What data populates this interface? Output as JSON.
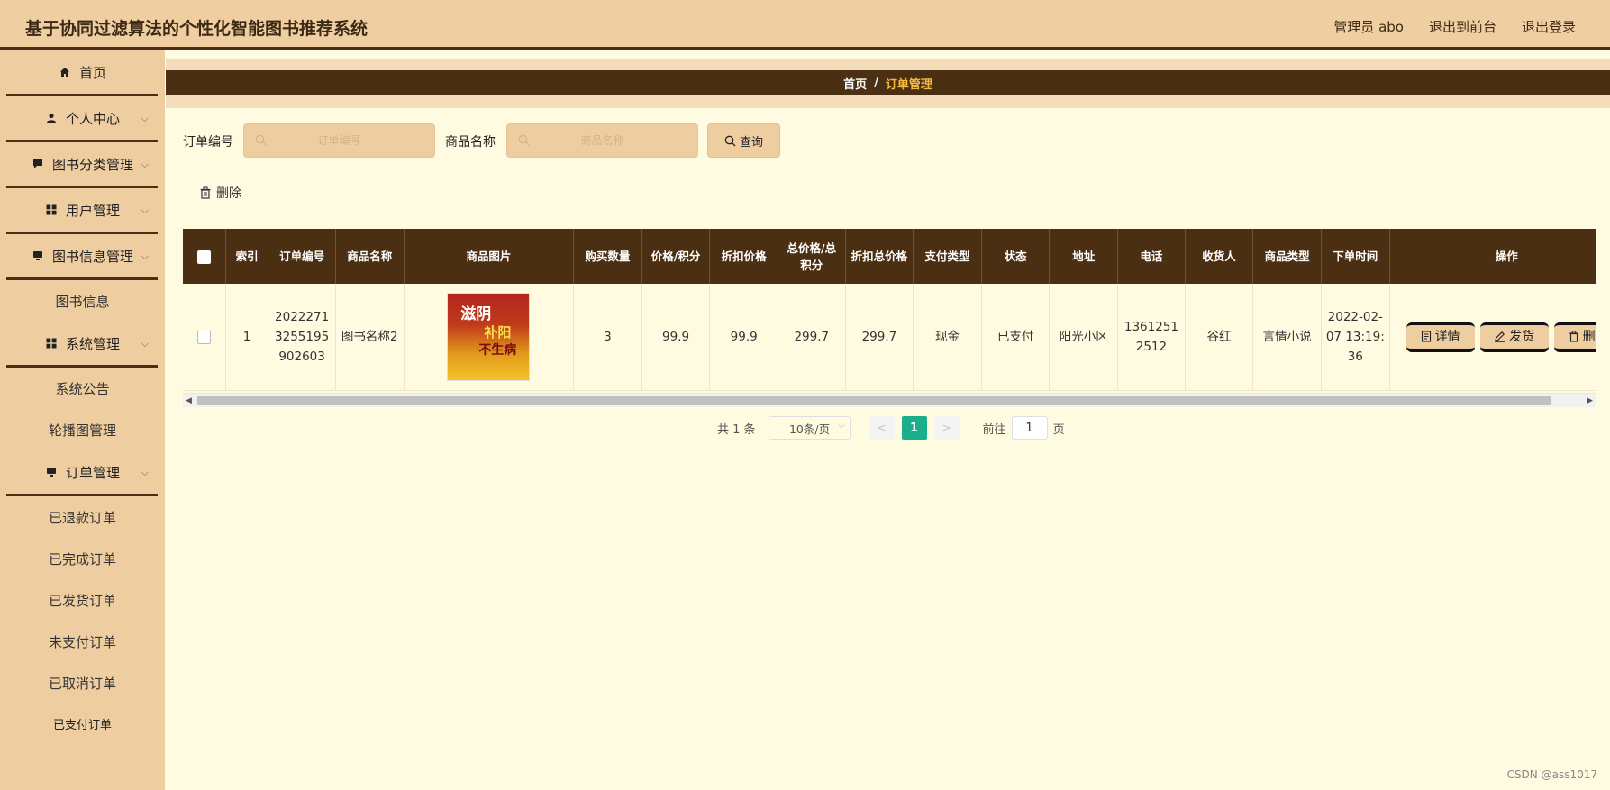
{
  "header": {
    "title": "基于协同过滤算法的个性化智能图书推荐系统",
    "user_label": "管理员 abo",
    "to_front_label": "退出到前台",
    "logout_label": "退出登录"
  },
  "sidebar": {
    "home": "首页",
    "personal": "个人中心",
    "book_category": "图书分类管理",
    "user_mgmt": "用户管理",
    "book_info_mgmt": "图书信息管理",
    "book_info": "图书信息",
    "system_mgmt": "系统管理",
    "announcement": "系统公告",
    "carousel": "轮播图管理",
    "order_mgmt": "订单管理",
    "refunded": "已退款订单",
    "completed": "已完成订单",
    "shipped": "已发货订单",
    "unpaid": "未支付订单",
    "cancelled": "已取消订单",
    "paid": "已支付订单"
  },
  "breadcrumb": {
    "home": "首页",
    "separator": "/",
    "current": "订单管理"
  },
  "search": {
    "order_no_label": "订单编号",
    "order_no_placeholder": "订单编号",
    "order_no_value": "",
    "product_name_label": "商品名称",
    "product_name_placeholder": "商品名称",
    "product_name_value": "",
    "query_label": "查询"
  },
  "actions": {
    "delete_label": "删除"
  },
  "table": {
    "headers": {
      "index": "索引",
      "order_no": "订单编号",
      "product_name": "商品名称",
      "product_image": "商品图片",
      "quantity": "购买数量",
      "price": "价格/积分",
      "discount_price": "折扣价格",
      "total": "总价格/总积分",
      "discount_total": "折扣总价格",
      "pay_type": "支付类型",
      "status": "状态",
      "address": "地址",
      "phone": "电话",
      "receiver": "收货人",
      "product_type": "商品类型",
      "order_time": "下单时间",
      "operation": "操作"
    },
    "rows": [
      {
        "index": "1",
        "order_no": "20222713255195902603",
        "product_name": "图书名称2",
        "image_texts": [
          "滋阴",
          "补阳",
          "不生病"
        ],
        "quantity": "3",
        "price": "99.9",
        "discount_price": "99.9",
        "total": "299.7",
        "discount_total": "299.7",
        "pay_type": "现金",
        "status": "已支付",
        "address": "阳光小区",
        "phone": "13612512512",
        "receiver": "谷红",
        "product_type": "言情小说",
        "order_time": "2022-02-07 13:19:36",
        "ops": {
          "detail": "详情",
          "ship": "发货",
          "delete": "删除"
        }
      }
    ]
  },
  "pagination": {
    "total_text": "共 1 条",
    "page_size": "10条/页",
    "current_page": "1",
    "goto_label": "前往",
    "goto_value": "1",
    "page_suffix": "页"
  },
  "watermark": "CSDN @ass1017",
  "colors": {
    "header_bg": "#EFCFA2",
    "dark_brown": "#4B2F12",
    "content_bg": "#FEFBE1",
    "accent_gold": "#F3B940",
    "page_active": "#1AAE8C"
  }
}
